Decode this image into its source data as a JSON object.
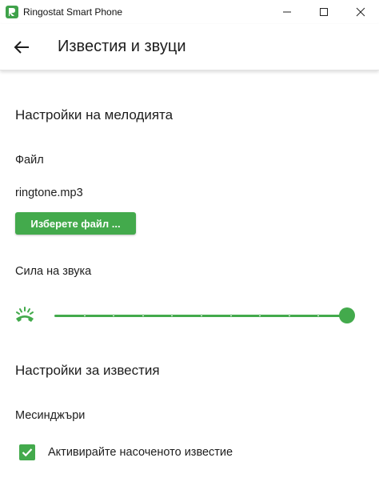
{
  "window": {
    "title": "Ringostat Smart Phone",
    "controls": [
      "minimize",
      "maximize",
      "close"
    ]
  },
  "header": {
    "back_icon": "arrow-left-icon",
    "title": "Известия и звуци"
  },
  "ringtone_section": {
    "title": "Настройки на мелодията",
    "file_label": "Файл",
    "file_name": "ringtone.mp3",
    "choose_file_label": "Изберете файл ..."
  },
  "volume": {
    "label": "Сила на звука",
    "icon": "ringing-phone-icon",
    "level": 1.0,
    "ticks": 10
  },
  "notifications_section": {
    "title": "Настройки за известия",
    "messengers_label": "Месинджъри",
    "targeted_notification": {
      "label": "Активирайте насоченото известие",
      "checked": true
    }
  },
  "colors": {
    "accent": "#43aa4c",
    "text": "#1d1d1d",
    "background": "#ffffff"
  }
}
